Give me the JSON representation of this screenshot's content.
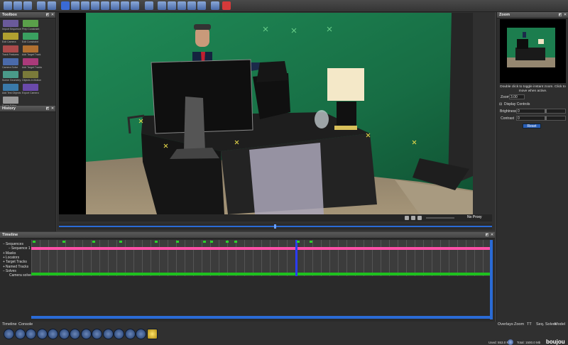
{
  "toolbar": {
    "icons": [
      "new-file-icon",
      "open-folder-icon",
      "save-icon",
      "undo-icon",
      "redo-icon",
      "select-icon",
      "track-icon",
      "pen-icon",
      "lasso-icon",
      "grid-icon",
      "view-icon",
      "zoom-icon",
      "fit-icon",
      "layout-icon",
      "camera-icon",
      "globe-icon",
      "sphere-icon",
      "rotate-icon",
      "hand-icon",
      "brush-icon",
      "magnet-icon"
    ]
  },
  "toolbox": {
    "title": "Toolbox",
    "tools": [
      {
        "label": "Import Sequence",
        "color": "#6a5a9a"
      },
      {
        "label": "Prep Constraint",
        "color": "#5aa04a"
      },
      {
        "label": "Edit Camera",
        "color": "#b0a030"
      },
      {
        "label": "Edit Constraint",
        "color": "#3aa060"
      },
      {
        "label": "Track Features",
        "color": "#aa4a4a"
      },
      {
        "label": "Add Target Track",
        "color": "#b07030"
      },
      {
        "label": "Camera Solve",
        "color": "#4a6aaa"
      },
      {
        "label": "Add Target Tracks",
        "color": "#aa3a7a"
      },
      {
        "label": "Scene Geometry",
        "color": "#4a9a8a"
      },
      {
        "label": "Objects in Motion",
        "color": "#7a7a3a"
      },
      {
        "label": "Add Test Objects",
        "color": "#3a7aaa"
      },
      {
        "label": "Export Camera",
        "color": "#6a4aaa"
      },
      {
        "label": "Scene Editor",
        "color": "#9a9a9a"
      }
    ]
  },
  "history": {
    "title": "History"
  },
  "viewer": {
    "proxy_label": "No Proxy"
  },
  "zoom": {
    "title": "Zoom",
    "hint": "Double click to toggle instant zoom. Click to move when active.",
    "zoom_label": "Zoom",
    "zoom_value": "3.00",
    "display_controls_label": "Display Controls",
    "brightness_label": "Brightness",
    "brightness_value": "0",
    "contrast_label": "Contrast",
    "contrast_value": "0",
    "reset_label": "Reset"
  },
  "timeline": {
    "title": "Timeline",
    "tree": [
      {
        "label": "Sequences",
        "indent": 0,
        "expander": "−"
      },
      {
        "label": "Sequence 1",
        "indent": 1,
        "expander": "−"
      },
      {
        "label": "Masks",
        "indent": 0,
        "expander": "+"
      },
      {
        "label": "Locators",
        "indent": 0,
        "expander": "+"
      },
      {
        "label": "Target Tracks",
        "indent": 0,
        "expander": "+"
      },
      {
        "label": "Named Tracks",
        "indent": 0,
        "expander": "+"
      },
      {
        "label": "Solves",
        "indent": 0,
        "expander": "−"
      },
      {
        "label": "Camera solve 1",
        "indent": 1,
        "expander": ""
      }
    ]
  },
  "bottom_tabs": {
    "left": [
      "Timeline",
      "Console"
    ],
    "right": [
      "Overlays",
      "Zoom",
      "TT",
      "Seq. Solver",
      "Model"
    ]
  },
  "status": {
    "used": "Used: 553.0 Mb",
    "total": "Total: 1500.0 Mb",
    "brand": "boujou"
  },
  "colors": {
    "accent": "#ff4fa8",
    "track_green": "#1fc01f",
    "playhead": "#2a3cff",
    "scroll_blue": "#2a6bd6"
  }
}
